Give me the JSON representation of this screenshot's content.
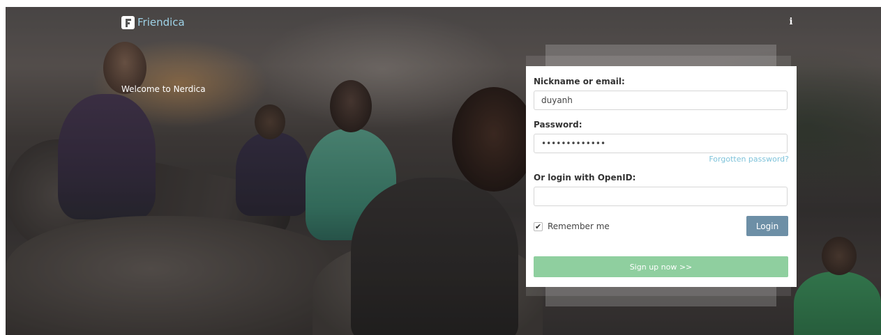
{
  "header": {
    "brand_name": "Friendica",
    "logo_icon": "friendica-logo-icon",
    "info_icon_glyph": "i"
  },
  "welcome_text": "Welcome to Nerdica",
  "login": {
    "nickname_label": "Nickname or email:",
    "nickname_value": "duyanh",
    "password_label": "Password:",
    "password_value": "•••••••••••••",
    "forgot_password": "Forgotten password?",
    "openid_label": "Or login with OpenID:",
    "openid_value": "",
    "remember_label": "Remember me",
    "remember_checked": true,
    "check_glyph": "✔",
    "login_button": "Login",
    "signup_button": "Sign up now >>"
  },
  "colors": {
    "brand_text": "#9fd3e8",
    "link": "#7fc3da",
    "login_button": "#6d8fa6",
    "signup_button": "#8fcf9f"
  }
}
